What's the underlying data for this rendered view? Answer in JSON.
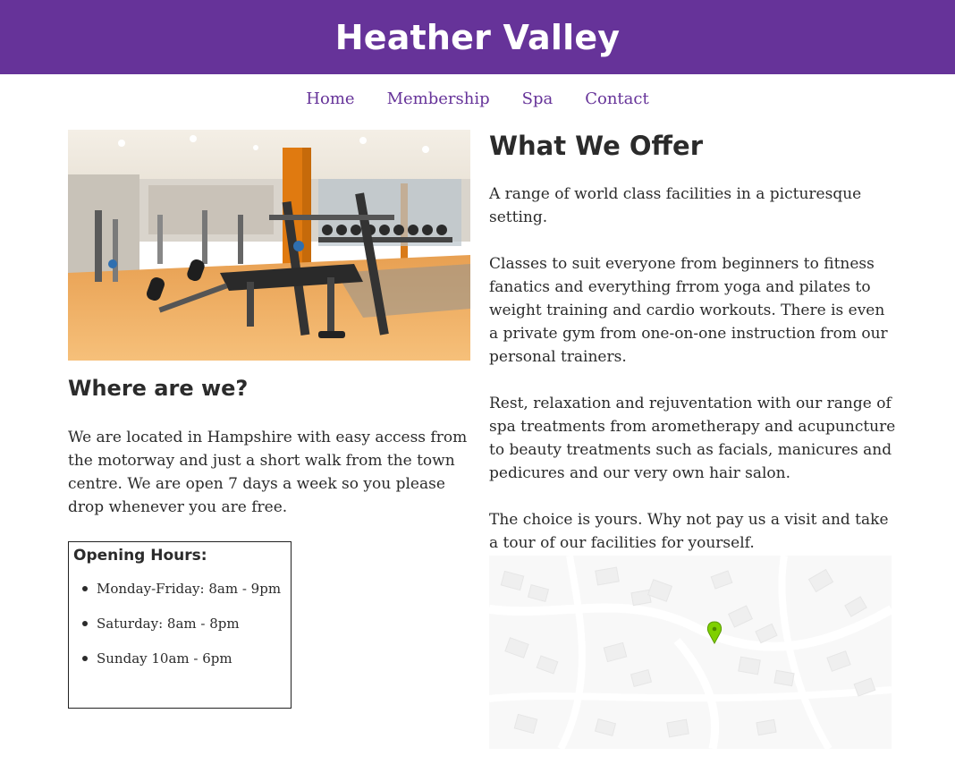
{
  "header": {
    "title": "Heather Valley"
  },
  "nav": {
    "items": [
      "Home",
      "Membership",
      "Spa",
      "Contact"
    ]
  },
  "where": {
    "heading": "Where are we?",
    "text": "We are located in Hampshire with easy access from the motorway and just a short walk from the town centre. We are open 7 days a week so you please drop whenever you are free."
  },
  "hours": {
    "heading": "Opening Hours:",
    "items": [
      "Monday-Friday: 8am - 9pm",
      "Saturday: 8am - 8pm",
      "Sunday 10am - 6pm"
    ]
  },
  "offer": {
    "heading": "What We Offer",
    "paragraphs": [
      "A range of world class facilities in a picturesque setting.",
      "Classes to suit everyone from beginners to fitness fanatics and everything frrom yoga and pilates to weight training and cardio workouts. There is even a private gym from one-on-one instruction from our personal trainers.",
      "Rest, relaxation and rejuventation with our range of spa treatments from arometherapy and acupuncture to beauty treatments such as facials, manicures and pedicures and our very own hair salon.",
      "The choice is yours. Why not pay us a visit and take a tour of our facilities for yourself."
    ]
  },
  "map": {
    "marker_icon": "map-pin-icon",
    "marker_color": "#7fd000"
  },
  "colors": {
    "brand": "#663399",
    "text": "#2b2b2b",
    "background": "#ffffff"
  }
}
